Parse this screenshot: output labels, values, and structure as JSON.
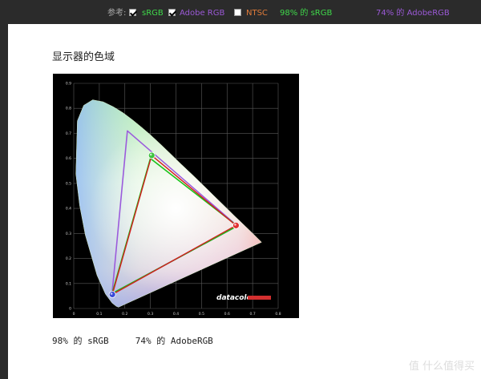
{
  "toolbar": {
    "reference_label": "参考:",
    "srgb_label": "sRGB",
    "adobe_label": "Adobe RGB",
    "ntsc_label": "NTSC",
    "srgb_coverage": "98% 的 sRGB",
    "adobe_coverage": "74% 的 AdobeRGB",
    "srgb_checked": true,
    "adobe_checked": true,
    "ntsc_checked": false,
    "colors": {
      "srgb": "#3fd84a",
      "adobe": "#9b59d6",
      "ntsc": "#e07b39",
      "label": "#aaaaaa"
    }
  },
  "article": {
    "heading": "显示器的色域",
    "caption": "98% 的 sRGB     74% 的 AdobeRGB",
    "watermark": "值 什么值得买"
  },
  "chart_data": {
    "type": "scatter",
    "xlim": [
      0,
      0.8
    ],
    "ylim": [
      0,
      0.9
    ],
    "x_ticks": [
      "0",
      "0.1",
      "0.2",
      "0.3",
      "0.4",
      "0.5",
      "0.6",
      "0.7",
      "0.8"
    ],
    "y_ticks": [
      "0",
      "0.1",
      "0.2",
      "0.3",
      "0.4",
      "0.5",
      "0.6",
      "0.7",
      "0.8",
      "0.9"
    ],
    "grid": true,
    "logo": "datacolor",
    "spectral_locus": [
      [
        0.175,
        0.005
      ],
      [
        0.166,
        0.009
      ],
      [
        0.15,
        0.022
      ],
      [
        0.124,
        0.058
      ],
      [
        0.091,
        0.133
      ],
      [
        0.045,
        0.295
      ],
      [
        0.023,
        0.413
      ],
      [
        0.008,
        0.538
      ],
      [
        0.014,
        0.75
      ],
      [
        0.039,
        0.812
      ],
      [
        0.074,
        0.834
      ],
      [
        0.115,
        0.826
      ],
      [
        0.155,
        0.806
      ],
      [
        0.193,
        0.782
      ],
      [
        0.23,
        0.754
      ],
      [
        0.266,
        0.724
      ],
      [
        0.302,
        0.692
      ],
      [
        0.337,
        0.659
      ],
      [
        0.373,
        0.624
      ],
      [
        0.408,
        0.589
      ],
      [
        0.444,
        0.554
      ],
      [
        0.479,
        0.52
      ],
      [
        0.512,
        0.487
      ],
      [
        0.575,
        0.424
      ],
      [
        0.627,
        0.372
      ],
      [
        0.666,
        0.334
      ],
      [
        0.692,
        0.308
      ],
      [
        0.735,
        0.265
      ]
    ],
    "srgb": [
      [
        0.64,
        0.33
      ],
      [
        0.3,
        0.6
      ],
      [
        0.15,
        0.06
      ]
    ],
    "adobe_rgb": [
      [
        0.64,
        0.33
      ],
      [
        0.21,
        0.71
      ],
      [
        0.15,
        0.06
      ]
    ],
    "measured": [
      [
        0.635,
        0.332
      ],
      [
        0.305,
        0.612
      ],
      [
        0.151,
        0.056
      ]
    ],
    "colors": {
      "srgb": "#19c219",
      "adobe": "#9b5bdc",
      "measured": "#d21e1e",
      "white_point": "#ffffff"
    }
  }
}
